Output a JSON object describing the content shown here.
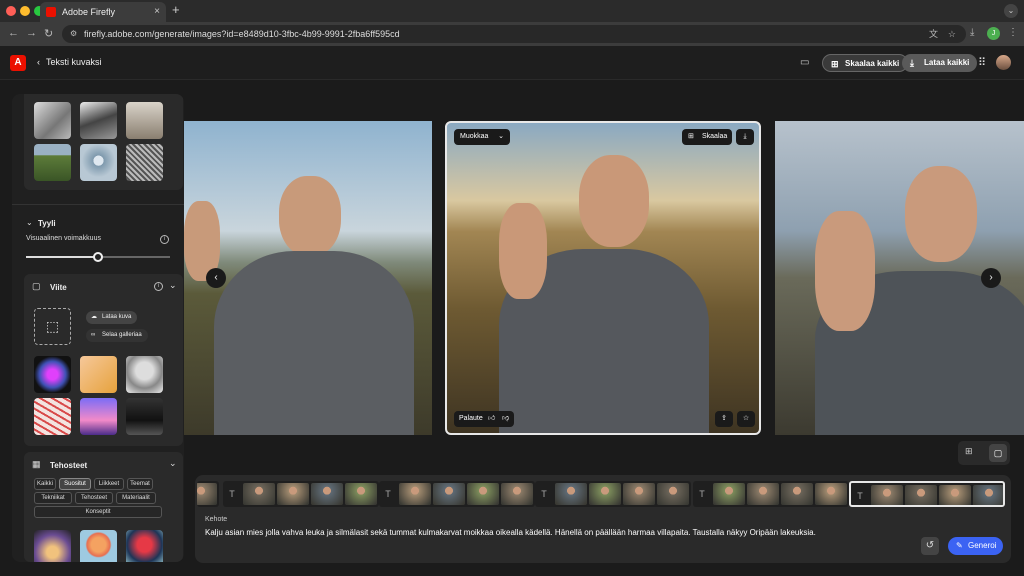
{
  "browser": {
    "tab_title": "Adobe Firefly",
    "tab_close": "×",
    "new_tab": "+",
    "url": "firefly.adobe.com/generate/images?id=e8489d10-3fbc-4b99-9991-2fba6ff595cd",
    "profile_initial": "J"
  },
  "header": {
    "logo": "A",
    "back_label": "Teksti kuvaksi",
    "upscale_all": "Skaalaa kaikki",
    "download_all": "Lataa kaikki"
  },
  "sidebar": {
    "style_section": "Tyyli",
    "visual_intensity": "Visuaalinen voimakkuus",
    "slider_value": 0.5,
    "reference": {
      "title": "Viite",
      "upload": "Lataa kuva",
      "browse": "Selaa galleriaa"
    },
    "effects": {
      "title": "Tehosteet",
      "chips": [
        "Kaikki",
        "Suositut",
        "Liikkeet",
        "Teemat",
        "Tekniikat",
        "Tehosteet",
        "Materiaalit",
        "Konseptit"
      ],
      "selected": "Suositut"
    }
  },
  "gallery": {
    "edit_menu": "Muokkaa",
    "upscale": "Skaalaa",
    "feedback": "Palaute"
  },
  "prompt": {
    "label": "Kehote",
    "text": "Kalju asian mies jolla vahva leuka ja silmälasit sekä tummat kulmakarvat moikkaa oikealla kädellä. Hänellä on päällään harmaa villapaita. Taustalla näkyy Oripään lakeuksia.",
    "generate": "Generoi"
  },
  "colors": {
    "accent_blue": "#3b63f3",
    "adobe_red": "#eb1000",
    "selected_border": "#e8e8e8"
  }
}
